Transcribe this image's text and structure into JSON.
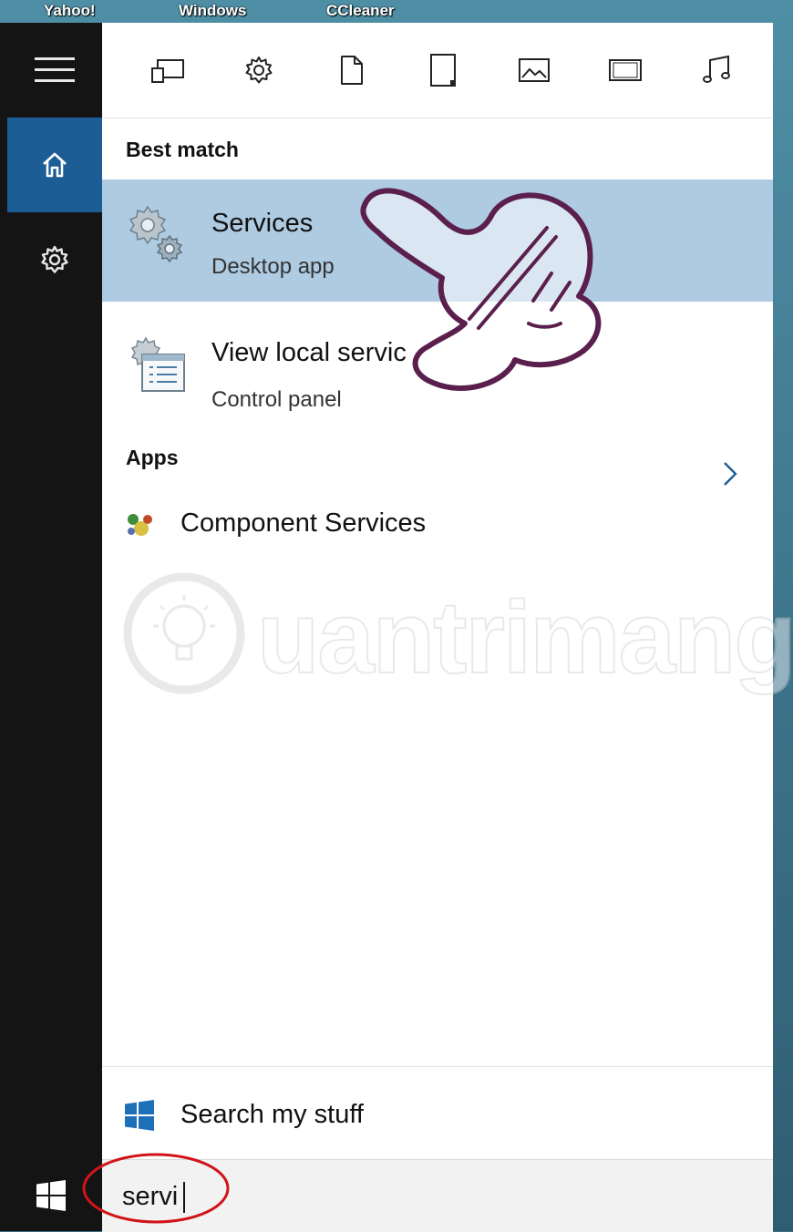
{
  "desktop": {
    "labels": [
      "Yahoo!",
      "Windows",
      "CCleaner"
    ]
  },
  "rail": {
    "menu_icon": "hamburger-icon",
    "home_icon": "home-icon",
    "settings_icon": "gear-icon",
    "active_color": "#1d5d96"
  },
  "filters": [
    "apps-icon",
    "settings-icon",
    "documents-icon",
    "folders-icon",
    "photos-icon",
    "videos-icon",
    "music-icon"
  ],
  "best_match": {
    "heading": "Best match",
    "items": [
      {
        "title": "Services",
        "subtitle": "Desktop app",
        "icon": "services-gears-icon",
        "highlighted": true
      },
      {
        "title": "View local servic",
        "subtitle": "Control panel",
        "icon": "control-panel-icon",
        "highlighted": false
      }
    ]
  },
  "apps": {
    "heading": "Apps",
    "items": [
      {
        "title": "Component Services",
        "icon": "component-services-icon"
      }
    ]
  },
  "watermark": {
    "text": "uantrimang"
  },
  "search_my_stuff": {
    "label": "Search my stuff",
    "icon": "windows-logo-icon"
  },
  "search": {
    "value": "servi"
  },
  "taskbar": {
    "start_icon": "windows-start-icon"
  },
  "colors": {
    "highlight": "#aecbe2",
    "rail": "#141414",
    "annotation": "#d0141a",
    "hand": "#5b1f4e"
  }
}
